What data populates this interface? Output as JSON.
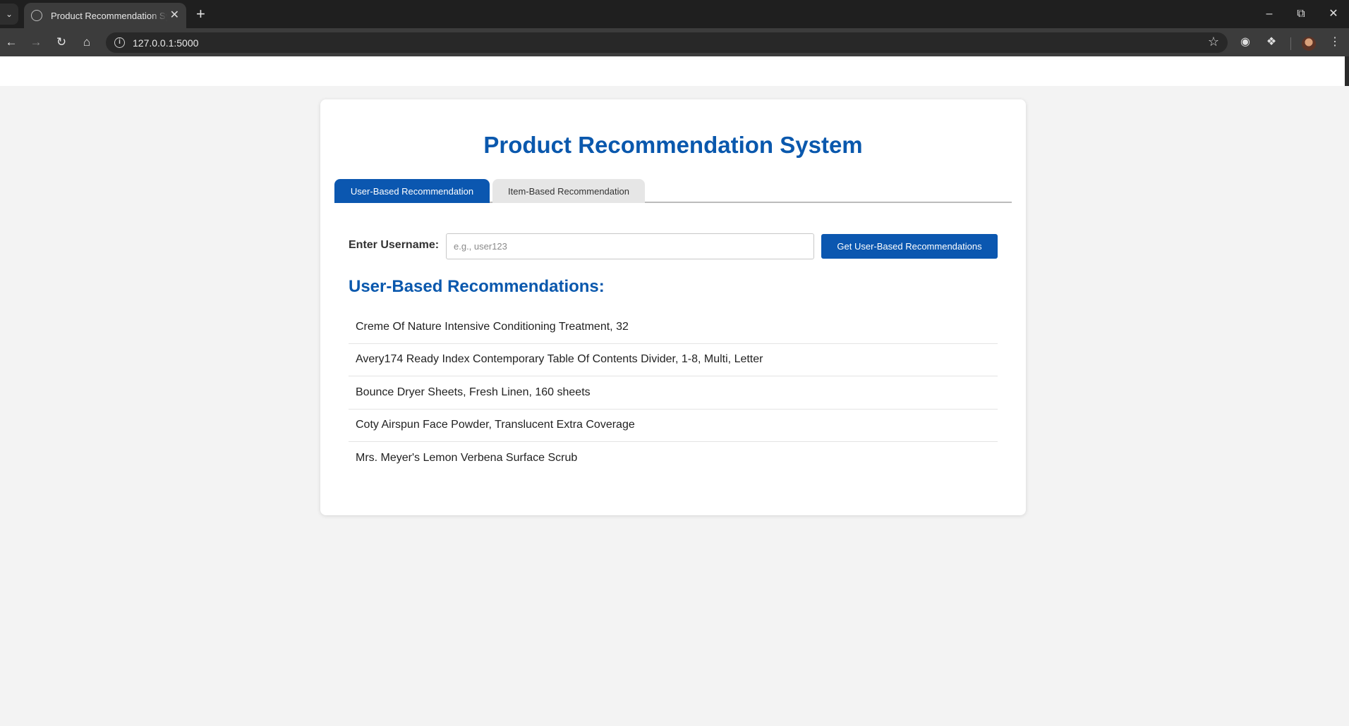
{
  "browser": {
    "tab_title": "Product Recommendation System",
    "url": "127.0.0.1:5000"
  },
  "page": {
    "title": "Product Recommendation System",
    "tabs": [
      {
        "label": "User-Based Recommendation",
        "active": true
      },
      {
        "label": "Item-Based Recommendation",
        "active": false
      }
    ],
    "form": {
      "label": "Enter Username:",
      "placeholder": "e.g., user123",
      "value": "",
      "button_label": "Get User-Based Recommendations"
    },
    "results": {
      "heading": "User-Based Recommendations:",
      "items": [
        "Creme Of Nature Intensive Conditioning Treatment, 32",
        "Avery174 Ready Index Contemporary Table Of Contents Divider, 1-8, Multi, Letter",
        "Bounce Dryer Sheets, Fresh Linen, 160 sheets",
        "Coty Airspun Face Powder, Translucent Extra Coverage",
        "Mrs. Meyer's Lemon Verbena Surface Scrub"
      ]
    }
  },
  "colors": {
    "accent": "#0b57b0",
    "heading": "#0a58ad",
    "page_bg": "#f3f3f3"
  }
}
